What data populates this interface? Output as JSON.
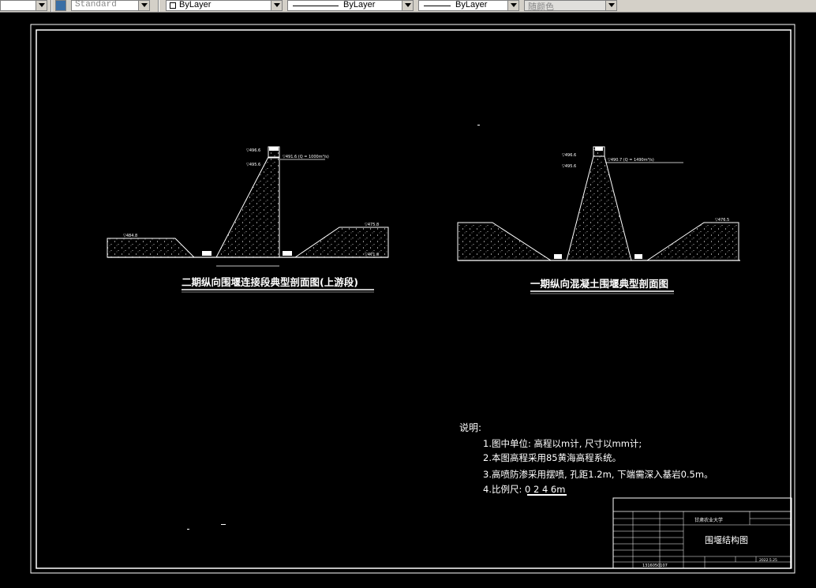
{
  "toolbar": {
    "textstyle_value": "Standard",
    "layer_value": "ByLayer",
    "linetype_value": "ByLayer",
    "lineweight_value": "ByLayer",
    "color_value": "随颜色"
  },
  "drawing": {
    "left_section": {
      "title": "二期纵向围堰连接段典型剖面图(上游段)",
      "elev_top": "▽496.6",
      "elev_crest": "▽495.6",
      "elev_level": "▽491.6 (Q = 1000m³/s)",
      "elev_left": "▽484.8",
      "elev_right_top": "▽475.8",
      "elev_right_bottom": "▽471.0"
    },
    "right_section": {
      "title": "一期纵向混凝土围堰典型剖面图",
      "elev_top": "▽496.6",
      "elev_crest": "▽495.6",
      "elev_level": "▽490.7 (Q = 1490m³/s)",
      "elev_right": "▽476.5"
    },
    "notes": {
      "heading": "说明:",
      "items": [
        "1.图中单位: 高程以m计, 尺寸以mm计;",
        "2.本图高程采用85黄海高程系统。",
        "3.高喷防渗采用摆喷, 孔距1.2m, 下端需深入基岩0.5m。",
        "4.比例尺: 0  2  4  6m"
      ]
    },
    "title_block": {
      "school": "甘肃农业大学",
      "drawing_name": "围堰结构图",
      "date": "2022.5.25",
      "student_id": "1316050107"
    }
  }
}
